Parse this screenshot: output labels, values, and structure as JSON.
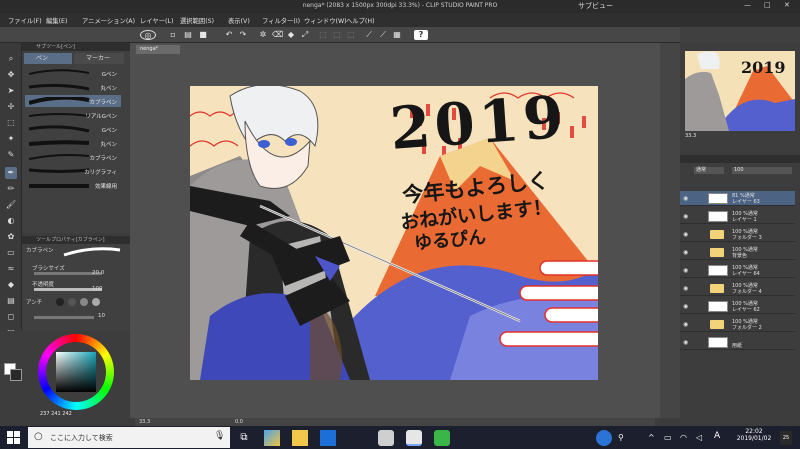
{
  "window": {
    "title": "nenga* (2083 x 1500px 300dpi 33.3%) - CLIP STUDIO PAINT PRO",
    "sub_window": "サブビュー",
    "controls": [
      "—",
      "□",
      "✕"
    ]
  },
  "menu": [
    "ファイル(F)",
    "編集(E)",
    "アニメーション(A)",
    "レイヤー(L)",
    "選択範囲(S)",
    "表示(V)",
    "フィルター(I)",
    "ウィンドウ(W)",
    "ヘルプ(H)"
  ],
  "subtool_panel": {
    "header": "サブツール[ペン]",
    "tabs": [
      "ペン",
      "マーカー"
    ],
    "pens": [
      "Gペン",
      "丸ペン",
      "カブラペン",
      "リアルGペン",
      "Gペン",
      "丸ペン",
      "カブラペン",
      "カリグラフィ",
      "効果線用"
    ],
    "selected_index": 2
  },
  "tool_property": {
    "header": "ツールプロパティ[カブラペン]",
    "brush_name": "カブラペン",
    "brush_size_label": "ブラシサイズ",
    "brush_size_value": "20.0",
    "opacity_label": "不透明度",
    "opacity_value": "100",
    "aa_label": "アンチ",
    "stabilization_value": "10"
  },
  "color": {
    "main": "#ffffff",
    "readout_r": "237",
    "readout_g": "241",
    "readout_b": "242"
  },
  "document": {
    "tab": "nenga*"
  },
  "artwork": {
    "year": "2019",
    "line1": "今年もよろしく",
    "line2": "おねがいします！",
    "signature": "ゆるぴん"
  },
  "status": {
    "zoom": "33.3",
    "angle": "0.0"
  },
  "navigator": {
    "zoom": "33.3",
    "rotation": "0.0"
  },
  "layer_panel": {
    "blend_mode": "通常",
    "opacity": "100",
    "layers": [
      {
        "line1": "81 %通常",
        "line2": "レイヤー 63",
        "selected": true,
        "folder": false
      },
      {
        "line1": "100 %通常",
        "line2": "レイヤー 1",
        "selected": false,
        "folder": false
      },
      {
        "line1": "100 %通常",
        "line2": "フォルダー 3",
        "selected": false,
        "folder": true
      },
      {
        "line1": "100 %通常",
        "line2": "背景色",
        "selected": false,
        "folder": true
      },
      {
        "line1": "100 %通常",
        "line2": "レイヤー 64",
        "selected": false,
        "folder": false
      },
      {
        "line1": "100 %通常",
        "line2": "フォルダー 4",
        "selected": false,
        "folder": true
      },
      {
        "line1": "100 %通常",
        "line2": "レイヤー 62",
        "selected": false,
        "folder": false
      },
      {
        "line1": "100 %通常",
        "line2": "フォルダー 2",
        "selected": false,
        "folder": true
      },
      {
        "line1": "",
        "line2": "用紙",
        "selected": false,
        "folder": false
      }
    ]
  },
  "taskbar": {
    "search_placeholder": "ここに入力して検索",
    "ime": "A",
    "time": "22:02",
    "date": "2019/01/02",
    "notifications": "25"
  }
}
